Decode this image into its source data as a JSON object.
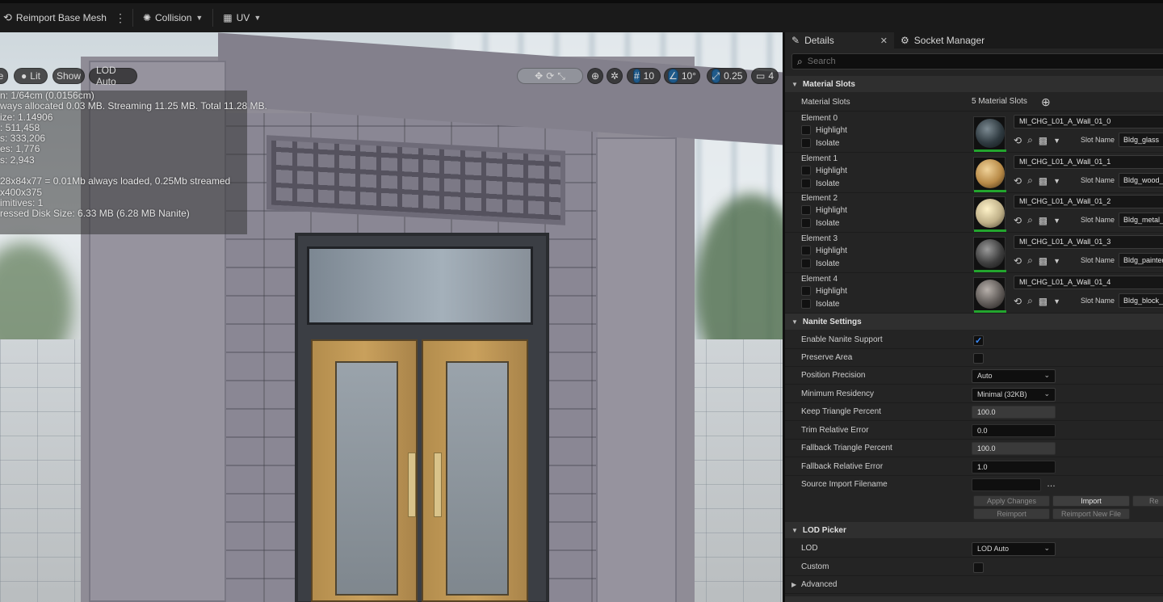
{
  "toolbar": {
    "reimport_label": "Reimport Base Mesh",
    "collision_label": "Collision",
    "uv_label": "UV"
  },
  "viewport": {
    "view_mode_partial": "e",
    "lit_label": "Lit",
    "show_label": "Show",
    "lod_label": "LOD Auto",
    "grid_value": "10",
    "angle_value": "10°",
    "scale_value": "0.25",
    "camera_value": "4",
    "stats": [
      "n: 1/64cm (0.0156cm)",
      "ways allocated 0.03 MB. Streaming 11.25 MB. Total 11.28 MB.",
      "ize:  1.14906",
      ": 511,458",
      "s: 333,206",
      "es: 1,776",
      "s: 2,943",
      "",
      "28x84x77 = 0.01Mb always loaded, 0.25Mb streamed",
      "x400x375",
      "imitives:  1",
      "ressed Disk Size: 6.33 MB (6.28 MB Nanite)"
    ]
  },
  "tabs": {
    "details": "Details",
    "socket_manager": "Socket Manager"
  },
  "search": {
    "placeholder": "Search"
  },
  "material_slots": {
    "header": "Material Slots",
    "row_label": "Material Slots",
    "count_text": "5 Material Slots",
    "highlight_label": "Highlight",
    "isolate_label": "Isolate",
    "slot_name_label": "Slot Name",
    "elements": [
      {
        "name": "Element 0",
        "material": "MI_CHG_L01_A_Wall_01_0",
        "slot": "Bldg_glass",
        "color": "#2f3a40"
      },
      {
        "name": "Element 1",
        "material": "MI_CHG_L01_A_Wall_01_1",
        "slot": "Bldg_wood_d",
        "color": "#b88a47"
      },
      {
        "name": "Element 2",
        "material": "MI_CHG_L01_A_Wall_01_2",
        "slot": "Bldg_metal_b",
        "color": "#bfb088"
      },
      {
        "name": "Element 3",
        "material": "MI_CHG_L01_A_Wall_01_3",
        "slot": "Bldg_painted",
        "color": "#3e3e3e"
      },
      {
        "name": "Element 4",
        "material": "MI_CHG_L01_A_Wall_01_4",
        "slot": "Bldg_block_l",
        "color": "#5f5a57"
      }
    ]
  },
  "nanite": {
    "header": "Nanite Settings",
    "enable_label": "Enable Nanite Support",
    "enable_value": true,
    "preserve_label": "Preserve Area",
    "preserve_value": false,
    "precision_label": "Position Precision",
    "precision_value": "Auto",
    "residency_label": "Minimum Residency",
    "residency_value": "Minimal (32KB)",
    "keep_tri_label": "Keep Triangle Percent",
    "keep_tri_value": "100.0",
    "trim_label": "Trim Relative Error",
    "trim_value": "0.0",
    "fallback_tri_label": "Fallback Triangle Percent",
    "fallback_tri_value": "100.0",
    "fallback_err_label": "Fallback Relative Error",
    "fallback_err_value": "1.0",
    "source_label": "Source Import Filename",
    "source_value": "",
    "apply_label": "Apply Changes",
    "import_label": "Import",
    "re_label": "Re",
    "reimport_label": "Reimport",
    "reimport_new_label": "Reimport New File"
  },
  "lod_picker": {
    "header": "LOD Picker",
    "lod_label": "LOD",
    "lod_value": "LOD Auto",
    "custom_label": "Custom",
    "advanced_label": "Advanced"
  }
}
